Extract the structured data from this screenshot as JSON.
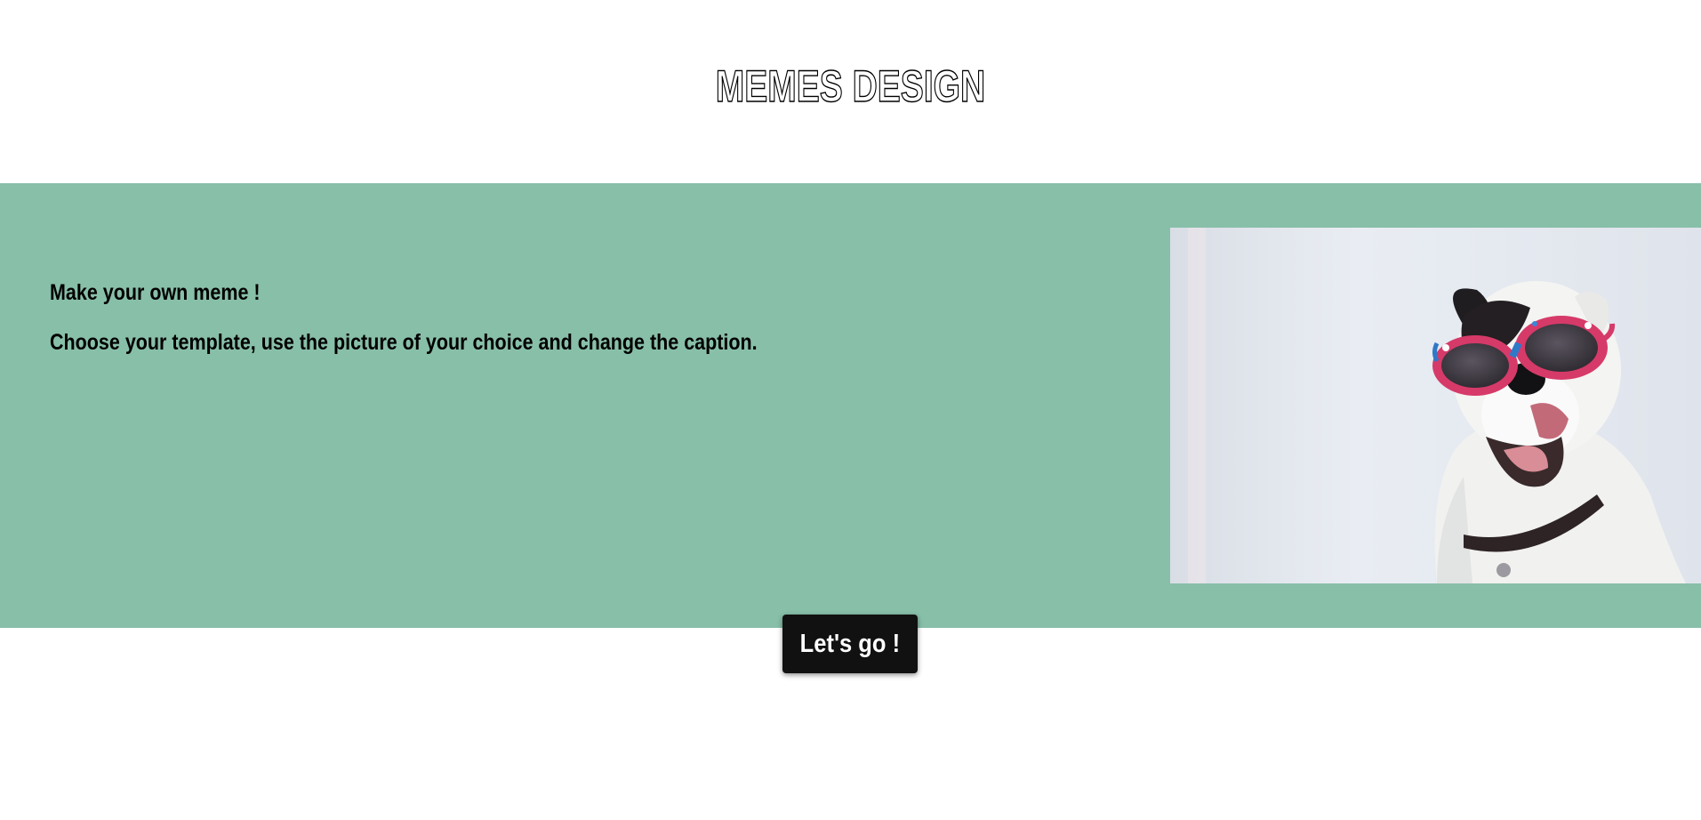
{
  "header": {
    "title": "MEMES DESIGN"
  },
  "hero": {
    "headline": "Make your own meme !",
    "description": "Choose your template, use the picture of your choice and change the caption.",
    "background_color": "#88bfa9",
    "image": {
      "subject": "dog-with-sunglasses-photo"
    }
  },
  "cta": {
    "label": "Let's go !",
    "background_color": "#111111"
  }
}
